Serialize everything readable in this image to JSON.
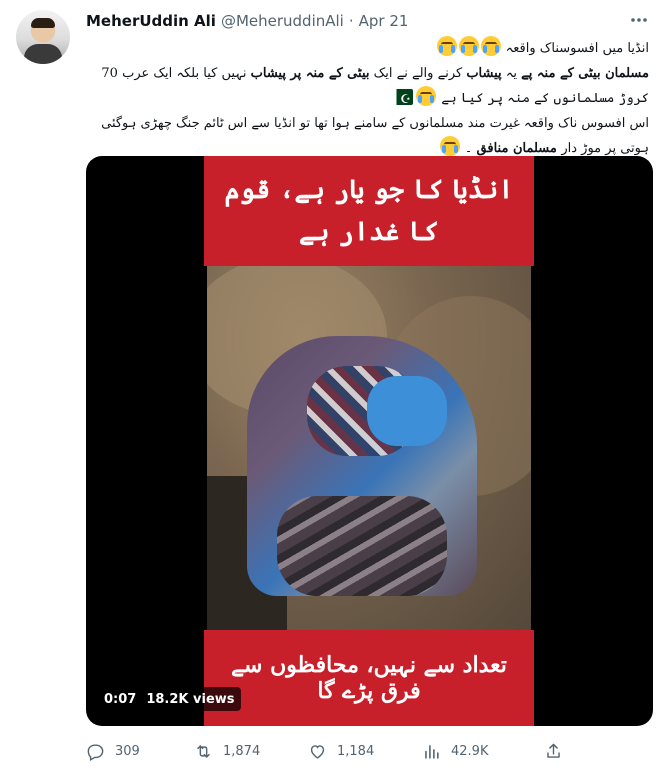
{
  "author": {
    "name": "MeherUddin Ali",
    "handle": "@MeheruddinAli",
    "separator": "·",
    "date": "Apr 21"
  },
  "tweet": {
    "line1": "انڈیا میں افسوسناک واقعہ",
    "line2_bold_a": "مسلمان بیٹی کے منہ پے",
    "line2_b": " یہ ",
    "line2_bold_c": "پیشاب",
    "line2_d": " کرنے والے نے ایک ",
    "line2_bold_e": "بیٹی کے منہ پر پیشاب",
    "line2_f": " نہیں کیا بلکہ ایک عرب 70 کروڑ مسلمانوں کے منہ پر کیا ہے",
    "line3_a": "اس افسوس ناک واقعہ غیرت مند مسلمانوں کے سامنے ہوا تھا تو انڈیا سے اس ٹائم جنگ چھڑی ہوگئی ہوتی پر موڑ دار",
    "line3_bold_b": " مسلمان منافق",
    "line3_c": " ۔"
  },
  "video": {
    "banner_top": "انڈیا کا جو یار ہے، قوم کا غدار ہے",
    "banner_bottom": "تعداد سے نہیں، محافظوں سے فرق پڑے گا",
    "time": "0:07",
    "views_label": "18.2K views"
  },
  "actions": {
    "replies": "309",
    "retweets": "1,874",
    "likes": "1,184",
    "views": "42.9K"
  },
  "icons": {
    "more": "more-icon",
    "reply": "reply-icon",
    "retweet": "retweet-icon",
    "like": "heart-icon",
    "views": "analytics-icon",
    "share": "share-icon",
    "emoji": "loudly-crying-face",
    "flag": "pakistan-flag"
  },
  "colors": {
    "banner": "#c8202a",
    "muted": "#536471"
  }
}
